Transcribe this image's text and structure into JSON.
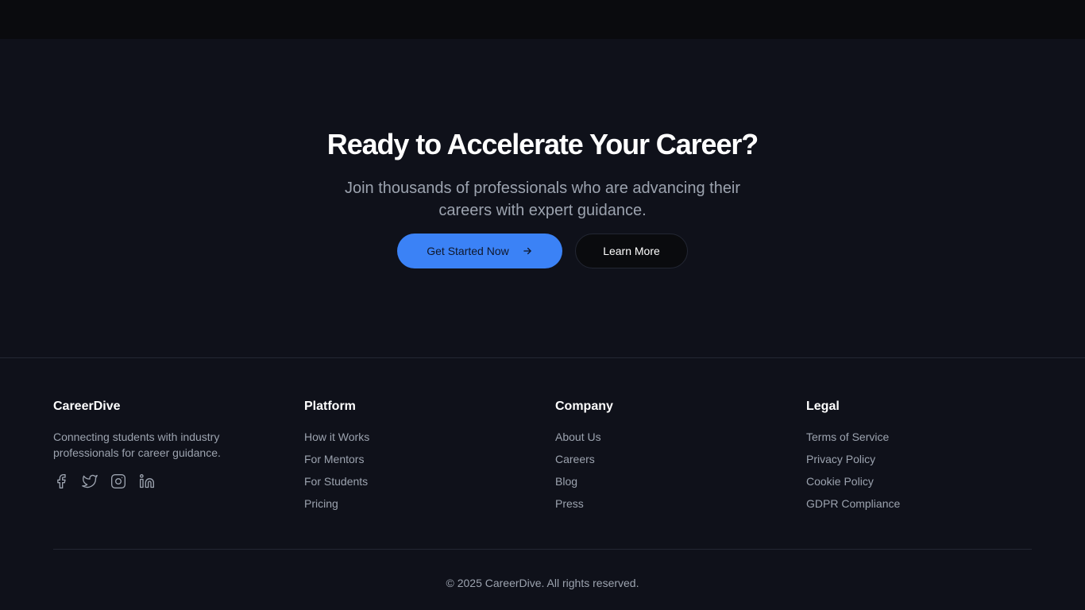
{
  "cta": {
    "title": "Ready to Accelerate Your Career?",
    "subtitle": "Join thousands of professionals who are advancing their careers with expert guidance.",
    "primary_button": "Get Started Now",
    "primary_icon": "arrow-right-icon",
    "secondary_button": "Learn More"
  },
  "footer": {
    "brand": {
      "name": "CareerDive",
      "description": "Connecting students with industry professionals for career guidance.",
      "socials": [
        "facebook-icon",
        "twitter-icon",
        "instagram-icon",
        "linkedin-icon"
      ]
    },
    "columns": [
      {
        "title": "Platform",
        "links": [
          "How it Works",
          "For Mentors",
          "For Students",
          "Pricing"
        ]
      },
      {
        "title": "Company",
        "links": [
          "About Us",
          "Careers",
          "Blog",
          "Press"
        ]
      },
      {
        "title": "Legal",
        "links": [
          "Terms of Service",
          "Privacy Policy",
          "Cookie Policy",
          "GDPR Compliance"
        ]
      }
    ],
    "copyright": "© 2025 CareerDive. All rights reserved."
  },
  "colors": {
    "page_background": "#0f111a",
    "topbar_background": "#0a0b0e",
    "accent": "#3b82f6",
    "muted_text": "#9ca3af",
    "border": "#232733"
  }
}
